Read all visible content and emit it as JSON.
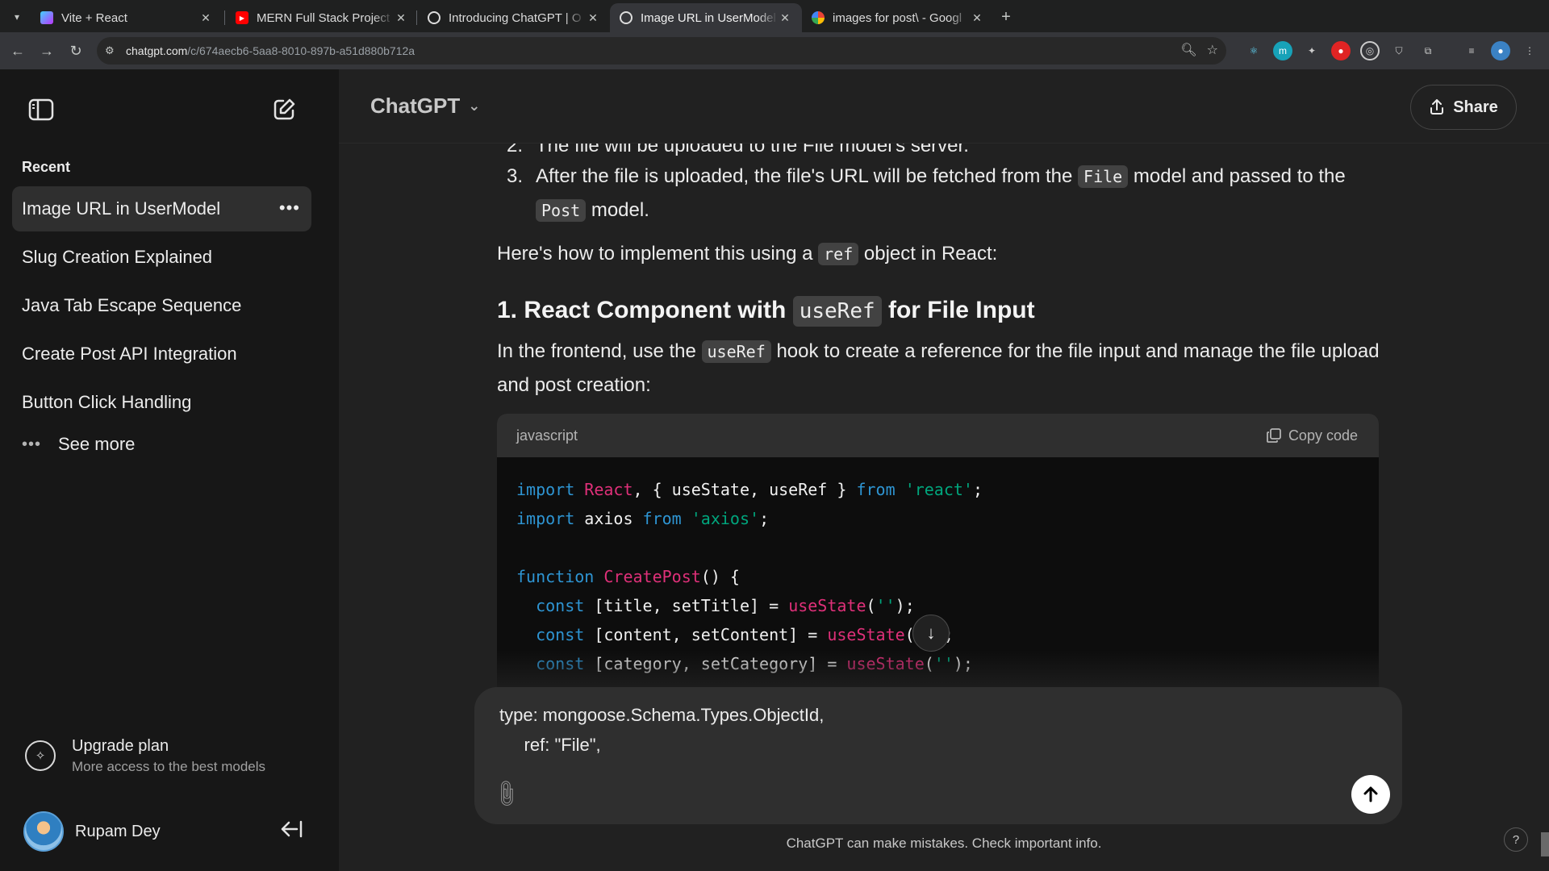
{
  "browser": {
    "tabs": [
      {
        "title": "Vite + React",
        "icon": "vite-icon",
        "active": false
      },
      {
        "title": "MERN Full Stack Project",
        "icon": "youtube-icon",
        "active": false
      },
      {
        "title": "Introducing ChatGPT | O",
        "icon": "openai-icon",
        "active": false
      },
      {
        "title": "Image URL in UserModel",
        "icon": "openai-icon",
        "active": true
      },
      {
        "title": "images for post\\ - Googl",
        "icon": "google-icon",
        "active": false
      }
    ],
    "url_host": "chatgpt.com",
    "url_path": "/c/674aecb6-5aa8-8010-897b-a51d880b712a"
  },
  "sidebar": {
    "recent_label": "Recent",
    "items": [
      {
        "label": "Image URL in UserModel",
        "selected": true
      },
      {
        "label": "Slug Creation Explained",
        "selected": false
      },
      {
        "label": "Java Tab Escape Sequence",
        "selected": false
      },
      {
        "label": "Create Post API Integration",
        "selected": false
      },
      {
        "label": "Button Click Handling",
        "selected": false
      }
    ],
    "see_more": "See more",
    "upgrade_title": "Upgrade plan",
    "upgrade_subtitle": "More access to the best models",
    "user_name": "Rupam Dey"
  },
  "header": {
    "model_name": "ChatGPT",
    "share_label": "Share"
  },
  "message": {
    "item2_cut": "The file will be uploaded to the File model's server.",
    "item3_number": "3.",
    "item3_a": "After the file is uploaded, the file's URL will be fetched from the",
    "item3_code1": "File",
    "item3_b": "model and passed to the",
    "item3_code2": "Post",
    "item3_c": "model.",
    "para1_a": "Here's how to implement this using a",
    "para1_code": "ref",
    "para1_b": "object in React:",
    "heading_a": "1. React Component with",
    "heading_code": "useRef",
    "heading_b": "for File Input",
    "para2_a": "In the frontend, use the",
    "para2_code": "useRef",
    "para2_b": "hook to create a reference for the file input and manage the file upload and post creation:",
    "code_lang": "javascript",
    "copy_label": "Copy code"
  },
  "composer": {
    "text_line1": "type: mongoose.Schema.Types.ObjectId,",
    "text_line2": "     ref: \"File\","
  },
  "footer": {
    "disclaimer": "ChatGPT can make mistakes. Check important info.",
    "help": "?"
  }
}
